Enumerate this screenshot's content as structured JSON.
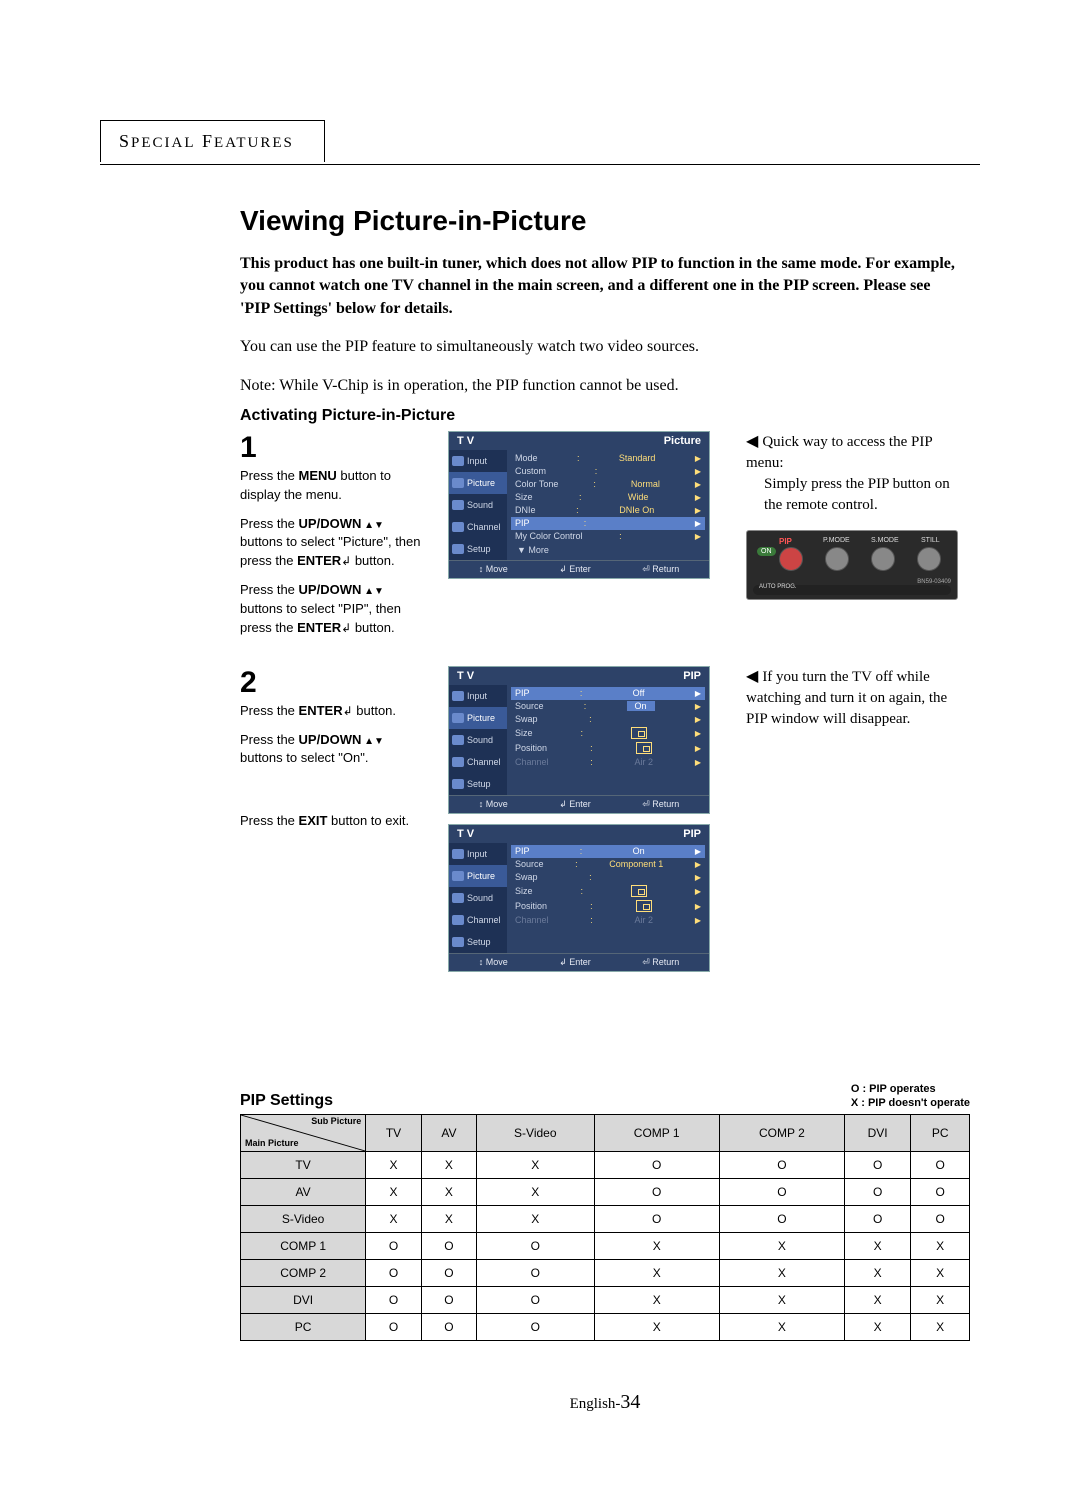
{
  "header": {
    "label": "SPECIAL FEATURES"
  },
  "title": "Viewing Picture-in-Picture",
  "intro_bold": "This product has one built-in tuner, which does not allow PIP to function in the same mode. For example, you cannot watch one TV channel in the main screen, and a different one in the PIP screen. Please see 'PIP Settings' below for details.",
  "intro_line1": "You can use the PIP feature to simultaneously watch two video sources.",
  "intro_line2": "Note: While V-Chip is in operation, the PIP function cannot be used.",
  "subheading": "Activating Picture-in-Picture",
  "step1": {
    "num": "1",
    "p1a": "Press the ",
    "p1b": "MENU",
    "p1c": " button to display the menu.",
    "p2a": "Press the ",
    "p2b": "UP/DOWN",
    "p2c": " buttons to select \"Picture\", then press the ",
    "p2d": "ENTER",
    "p2e": " button.",
    "p3a": "Press the ",
    "p3b": "UP/DOWN",
    "p3c": " buttons to select \"PIP\", then press the ",
    "p3d": "ENTER",
    "p3e": " button."
  },
  "step2": {
    "num": "2",
    "p1a": "Press the ",
    "p1b": "ENTER",
    "p1c": " button.",
    "p2a": "Press the ",
    "p2b": "UP/DOWN",
    "p2c": " buttons to select \"On\".",
    "p3a": "Press the ",
    "p3b": "EXIT",
    "p3c": " button to exit."
  },
  "osd1": {
    "left": "T V",
    "right": "Picture",
    "side": [
      "Input",
      "Picture",
      "Sound",
      "Channel",
      "Setup"
    ],
    "rows": [
      {
        "l": "Mode",
        "v": "Standard"
      },
      {
        "l": "Custom",
        "v": ""
      },
      {
        "l": "Color Tone",
        "v": "Normal"
      },
      {
        "l": "Size",
        "v": "Wide"
      },
      {
        "l": "DNIe",
        "v": "DNIe On"
      },
      {
        "l": "PIP",
        "v": "",
        "hl": true
      },
      {
        "l": "My Color Control",
        "v": ""
      }
    ],
    "more": "▼ More",
    "footer": [
      "↕ Move",
      "↲ Enter",
      "⏎ Return"
    ]
  },
  "osd2": {
    "left": "T V",
    "right": "PIP",
    "side": [
      "Input",
      "Picture",
      "Sound",
      "Channel",
      "Setup"
    ],
    "rows": [
      {
        "l": "PIP",
        "v": "Off",
        "hl": true
      },
      {
        "l": "Source",
        "v": "On",
        "valhl": true
      },
      {
        "l": "Swap",
        "v": ""
      },
      {
        "l": "Size",
        "v": "icon"
      },
      {
        "l": "Position",
        "v": "icon"
      },
      {
        "l": "Channel",
        "v": "Air    2",
        "dim": true
      }
    ],
    "footer": [
      "↕ Move",
      "↲ Enter",
      "⏎ Return"
    ]
  },
  "osd3": {
    "left": "T V",
    "right": "PIP",
    "side": [
      "Input",
      "Picture",
      "Sound",
      "Channel",
      "Setup"
    ],
    "rows": [
      {
        "l": "PIP",
        "v": "On",
        "hl": true
      },
      {
        "l": "Source",
        "v": "Component 1"
      },
      {
        "l": "Swap",
        "v": ""
      },
      {
        "l": "Size",
        "v": "icon"
      },
      {
        "l": "Position",
        "v": "icon"
      },
      {
        "l": "Channel",
        "v": "Air    2",
        "dim": true
      }
    ],
    "footer": [
      "↕ Move",
      "↲ Enter",
      "⏎ Return"
    ]
  },
  "side1": {
    "l1": "Quick way to access the PIP menu:",
    "l2": "Simply press the PIP button on the remote control."
  },
  "remote": {
    "pip": "PIP",
    "on": "ON",
    "pmode": "P.MODE",
    "smode": "S.MODE",
    "still": "STILL",
    "autoprog": "AUTO PROG.",
    "code": "BN59-03409"
  },
  "side2": "If you turn the TV off while watching and turn it on again, the PIP window will disappear.",
  "settings": {
    "title": "PIP Settings",
    "legend1": "O : PIP operates",
    "legend2": "X : PIP doesn't operate",
    "diag_sub": "Sub Picture",
    "diag_main": "Main Picture",
    "cols": [
      "TV",
      "AV",
      "S-Video",
      "COMP 1",
      "COMP 2",
      "DVI",
      "PC"
    ],
    "rows": [
      {
        "h": "TV",
        "c": [
          "X",
          "X",
          "X",
          "O",
          "O",
          "O",
          "O"
        ]
      },
      {
        "h": "AV",
        "c": [
          "X",
          "X",
          "X",
          "O",
          "O",
          "O",
          "O"
        ]
      },
      {
        "h": "S-Video",
        "c": [
          "X",
          "X",
          "X",
          "O",
          "O",
          "O",
          "O"
        ]
      },
      {
        "h": "COMP 1",
        "c": [
          "O",
          "O",
          "O",
          "X",
          "X",
          "X",
          "X"
        ]
      },
      {
        "h": "COMP 2",
        "c": [
          "O",
          "O",
          "O",
          "X",
          "X",
          "X",
          "X"
        ]
      },
      {
        "h": "DVI",
        "c": [
          "O",
          "O",
          "O",
          "X",
          "X",
          "X",
          "X"
        ]
      },
      {
        "h": "PC",
        "c": [
          "O",
          "O",
          "O",
          "X",
          "X",
          "X",
          "X"
        ]
      }
    ]
  },
  "pagenum": {
    "prefix": "English-",
    "num": "34"
  }
}
